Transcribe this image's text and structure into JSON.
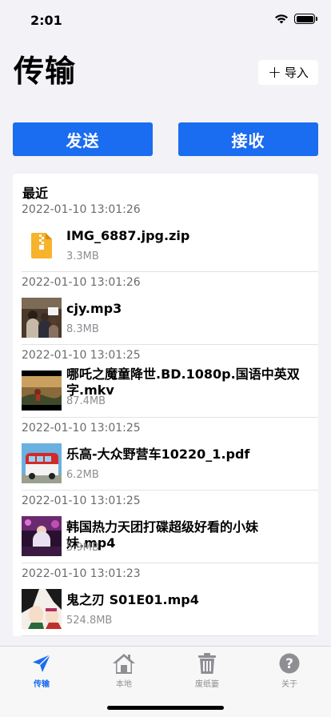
{
  "status_bar": {
    "time": "2:01"
  },
  "header": {
    "title": "传输",
    "import_label": "导入"
  },
  "actions": {
    "send_label": "发送",
    "receive_label": "接收"
  },
  "recent": {
    "title": "最近",
    "items": [
      {
        "time": "2022-01-10 13:01:26",
        "name": "IMG_6887.jpg.zip",
        "size": "3.3MB",
        "icon": "zip-file-icon"
      },
      {
        "time": "2022-01-10 13:01:26",
        "name": "cjy.mp3",
        "size": "8.3MB",
        "icon": "photo-thumbnail"
      },
      {
        "time": "2022-01-10 13:01:25",
        "name": "哪吒之魔童降世.BD.1080p.国语中英双字.mkv",
        "size": "87.4MB",
        "icon": "video-thumbnail"
      },
      {
        "time": "2022-01-10 13:01:25",
        "name": "乐高-大众野营车10220_1.pdf",
        "size": "6.2MB",
        "icon": "pdf-thumbnail"
      },
      {
        "time": "2022-01-10 13:01:25",
        "name": "韩国热力天团打碟超级好看的小妹妹.mp4",
        "size": "5.9MB",
        "icon": "video-thumbnail"
      },
      {
        "time": "2022-01-10 13:01:23",
        "name": "鬼之刃 S01E01.mp4",
        "size": "524.8MB",
        "icon": "video-thumbnail"
      }
    ]
  },
  "tabs": [
    {
      "label": "传输",
      "icon": "paper-plane-icon",
      "active": true
    },
    {
      "label": "本地",
      "icon": "home-icon",
      "active": false
    },
    {
      "label": "废纸篓",
      "icon": "trash-icon",
      "active": false
    },
    {
      "label": "关于",
      "icon": "question-icon",
      "active": false
    }
  ],
  "colors": {
    "accent": "#1a6cf0",
    "background": "#f2f2f7"
  }
}
